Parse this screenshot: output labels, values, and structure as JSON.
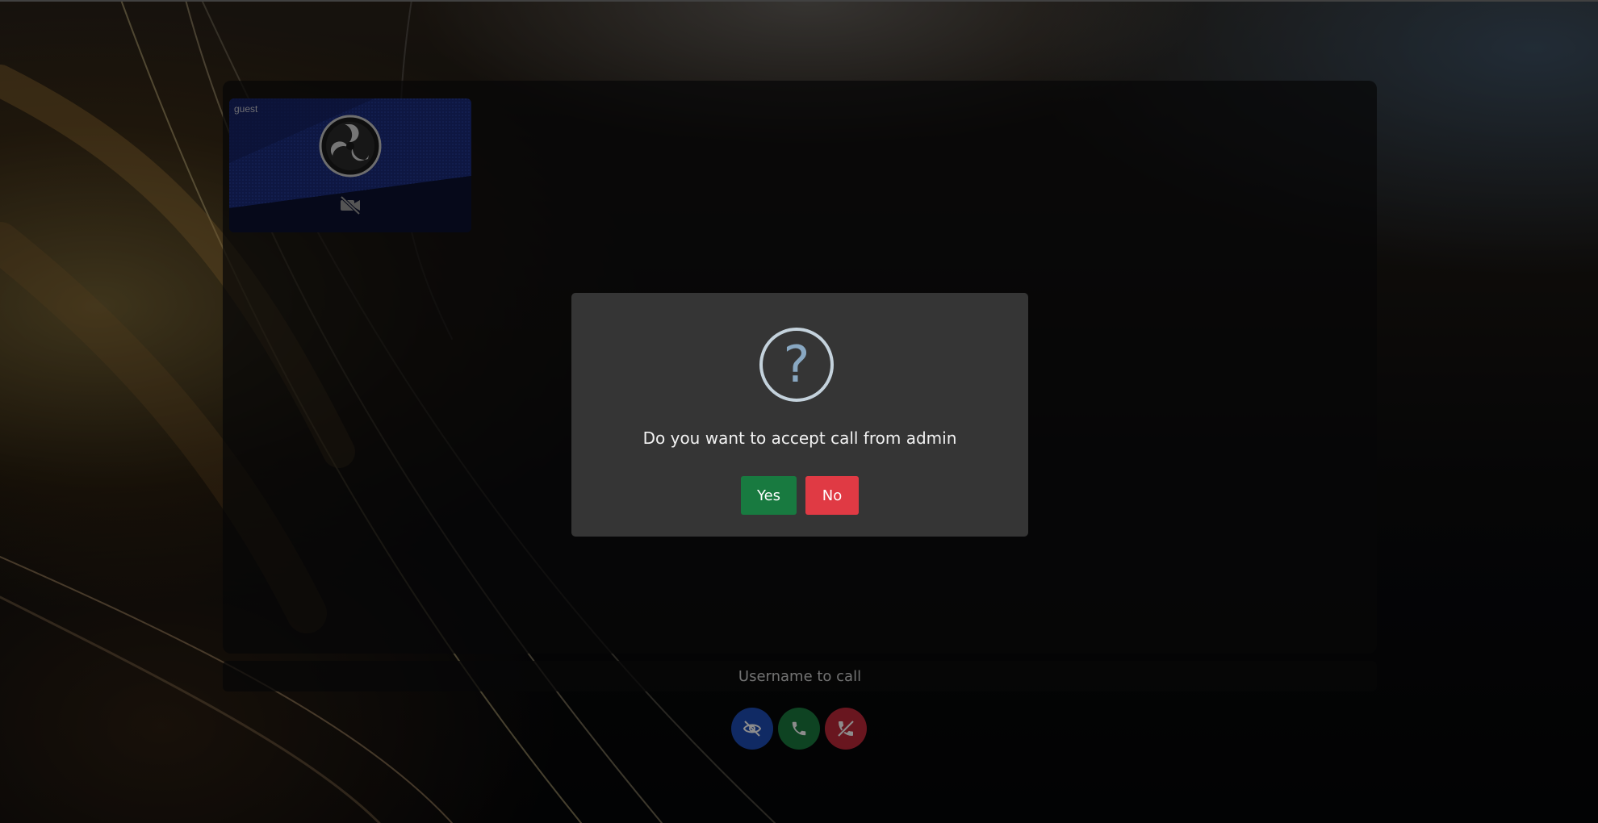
{
  "tile": {
    "label": "guest",
    "logo_icon": "obs-logo-icon",
    "camera_icon": "camera-off-icon"
  },
  "call_input": {
    "placeholder": "Username to call"
  },
  "controls": [
    {
      "name": "toggle-video-button",
      "icon": "eye-off-icon",
      "color": "#1e4db7"
    },
    {
      "name": "call-button",
      "icon": "phone-icon",
      "color": "#1a7a3f"
    },
    {
      "name": "hangup-button",
      "icon": "phone-off-icon",
      "color": "#c0283a"
    }
  ],
  "dialog": {
    "icon": "question-icon",
    "icon_glyph": "?",
    "message": "Do you want to accept call from admin",
    "yes_label": "Yes",
    "no_label": "No",
    "colors": {
      "yes": "#187a40",
      "no": "#e03a44",
      "background": "#353535"
    }
  }
}
